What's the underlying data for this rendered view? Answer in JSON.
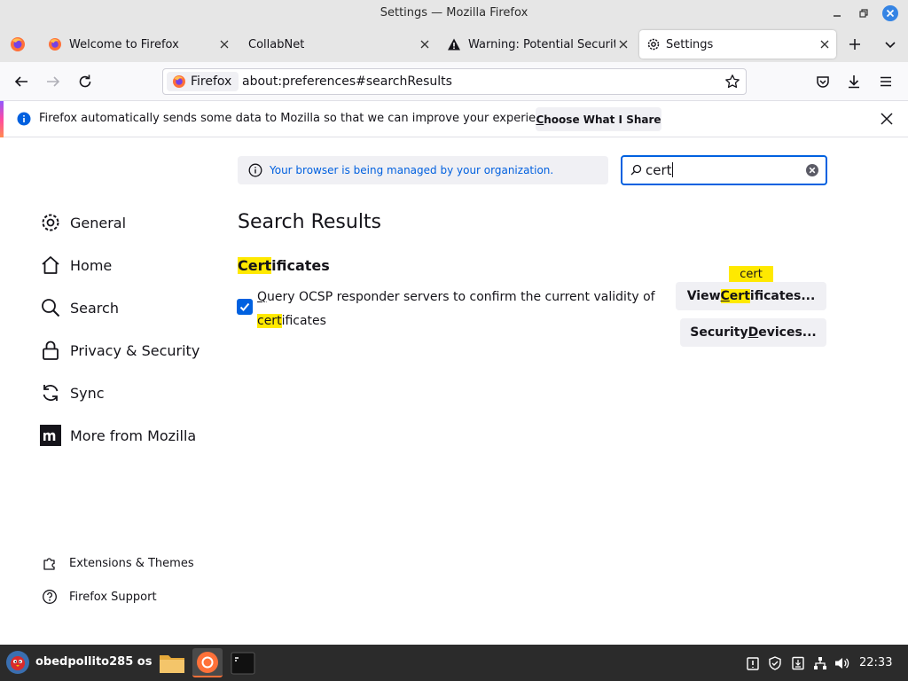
{
  "window": {
    "title": "Settings — Mozilla Firefox"
  },
  "tabs": [
    {
      "label": "Welcome to Firefox",
      "icon": "firefox-icon"
    },
    {
      "label": "CollabNet",
      "icon": ""
    },
    {
      "label": "Warning: Potential Security",
      "icon": "warning-icon"
    },
    {
      "label": "Settings",
      "icon": "gear-icon",
      "active": true
    }
  ],
  "urlbar": {
    "identity": "Firefox",
    "url": "about:preferences#searchResults"
  },
  "notification": {
    "text": "Firefox automatically sends some data to Mozilla so that we can improve your experience.",
    "button_prefix": "C",
    "button_rest": "hoose What I Share"
  },
  "managed_notice": "Your browser is being managed by your organization.",
  "search": {
    "value": "cert"
  },
  "sidebar": {
    "items": [
      {
        "label": "General",
        "icon": "gear-icon"
      },
      {
        "label": "Home",
        "icon": "home-icon"
      },
      {
        "label": "Search",
        "icon": "search-icon"
      },
      {
        "label": "Privacy & Security",
        "icon": "lock-icon"
      },
      {
        "label": "Sync",
        "icon": "sync-icon"
      },
      {
        "label": "More from Mozilla",
        "icon": "mozilla-icon"
      }
    ],
    "footer": [
      {
        "label": "Extensions & Themes",
        "icon": "puzzle-icon"
      },
      {
        "label": "Firefox Support",
        "icon": "help-icon"
      }
    ]
  },
  "results": {
    "heading": "Search Results",
    "section": {
      "hl": "Cert",
      "rest": "ificates"
    },
    "ocsp": {
      "u": "Q",
      "part1": "uery OCSP responder servers to confirm the current validity of ",
      "hl": "cert",
      "part2": "ificates",
      "checked": true
    },
    "view_button": {
      "pre": "View ",
      "hl_u": "C",
      "hl_rest": "ert",
      "post": "ificates..."
    },
    "devices_button": {
      "pre": "Security ",
      "u": "D",
      "post": "evices..."
    },
    "tooltip": "cert"
  },
  "taskbar": {
    "user": "obedpollito285 os",
    "clock": "22:33"
  },
  "colors": {
    "accent": "#0061e0",
    "highlight": "#ffe900",
    "taskbar": "#2b2b2b",
    "link": "#0060df"
  }
}
